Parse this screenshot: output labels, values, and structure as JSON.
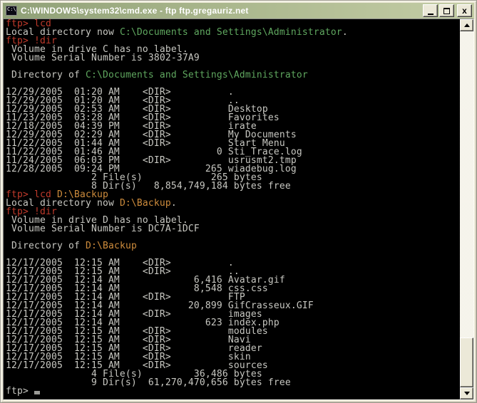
{
  "window": {
    "title": "C:\\WINDOWS\\system32\\cmd.exe - ftp ftp.gregauriz.net",
    "icon_label": "C:\\",
    "controls": {
      "minimize": "minimize-bar",
      "maximize": "square-outline",
      "close_glyph": "x"
    }
  },
  "colors": {
    "background": "#000000",
    "text": "#c8c8c2",
    "prompt_red": "#c03a2b",
    "path_green": "#5fa75f",
    "path_orange": "#ce8c3c",
    "titlebar_gradient_left": "#8fa077",
    "titlebar_gradient_right": "#c4cda6",
    "chrome_beige": "#ece9d8"
  },
  "icons": {
    "scroll_up": "triangle-up",
    "scroll_down": "triangle-down",
    "app": "cmd-console"
  },
  "console": {
    "show_cursor": true,
    "lines": [
      [
        {
          "c": "r",
          "t": "ftp> lcd"
        }
      ],
      [
        {
          "c": "w",
          "t": "Local directory now "
        },
        {
          "c": "g",
          "t": "C:\\Documents and Settings\\Administrator"
        },
        {
          "c": "w",
          "t": "."
        }
      ],
      [
        {
          "c": "r",
          "t": "ftp> !dir"
        }
      ],
      [
        {
          "c": "w",
          "t": " Volume in drive C has no label."
        }
      ],
      [
        {
          "c": "w",
          "t": " Volume Serial Number is 3802-37A9"
        }
      ],
      [],
      [
        {
          "c": "w",
          "t": " Directory of "
        },
        {
          "c": "g",
          "t": "C:\\Documents and Settings\\Administrator"
        }
      ],
      [],
      [
        {
          "c": "w",
          "t": "12/29/2005  01:20 AM    <DIR>          ."
        }
      ],
      [
        {
          "c": "w",
          "t": "12/29/2005  01:20 AM    <DIR>          .."
        }
      ],
      [
        {
          "c": "w",
          "t": "12/29/2005  02:53 AM    <DIR>          Desktop"
        }
      ],
      [
        {
          "c": "w",
          "t": "11/23/2005  03:28 AM    <DIR>          Favorites"
        }
      ],
      [
        {
          "c": "w",
          "t": "12/18/2005  04:39 PM    <DIR>          irate"
        }
      ],
      [
        {
          "c": "w",
          "t": "12/29/2005  02:29 AM    <DIR>          My Documents"
        }
      ],
      [
        {
          "c": "w",
          "t": "11/22/2005  01:44 AM    <DIR>          Start Menu"
        }
      ],
      [
        {
          "c": "w",
          "t": "11/22/2005  01:46 AM                 0 Sti_Trace.log"
        }
      ],
      [
        {
          "c": "w",
          "t": "11/24/2005  06:03 PM    <DIR>          usrusmt2.tmp"
        }
      ],
      [
        {
          "c": "w",
          "t": "12/28/2005  09:24 PM               265 wiadebug.log"
        }
      ],
      [
        {
          "c": "w",
          "t": "               2 File(s)            265 bytes"
        }
      ],
      [
        {
          "c": "w",
          "t": "               8 Dir(s)   8,854,749,184 bytes free"
        }
      ],
      [
        {
          "c": "r",
          "t": "ftp> lcd "
        },
        {
          "c": "o",
          "t": "D:\\Backup"
        }
      ],
      [
        {
          "c": "w",
          "t": "Local directory now "
        },
        {
          "c": "o",
          "t": "D:\\Backup"
        },
        {
          "c": "w",
          "t": "."
        }
      ],
      [
        {
          "c": "r",
          "t": "ftp> !dir"
        }
      ],
      [
        {
          "c": "w",
          "t": " Volume in drive D has no label."
        }
      ],
      [
        {
          "c": "w",
          "t": " Volume Serial Number is DC7A-1DCF"
        }
      ],
      [],
      [
        {
          "c": "w",
          "t": " Directory of "
        },
        {
          "c": "o",
          "t": "D:\\Backup"
        }
      ],
      [],
      [
        {
          "c": "w",
          "t": "12/17/2005  12:15 AM    <DIR>          ."
        }
      ],
      [
        {
          "c": "w",
          "t": "12/17/2005  12:15 AM    <DIR>          .."
        }
      ],
      [
        {
          "c": "w",
          "t": "12/17/2005  12:14 AM             6,416 Avatar.gif"
        }
      ],
      [
        {
          "c": "w",
          "t": "12/17/2005  12:14 AM             8,548 css.css"
        }
      ],
      [
        {
          "c": "w",
          "t": "12/17/2005  12:14 AM    <DIR>          FTP"
        }
      ],
      [
        {
          "c": "w",
          "t": "12/17/2005  12:14 AM            20,899 GifCrasseux.GIF"
        }
      ],
      [
        {
          "c": "w",
          "t": "12/17/2005  12:14 AM    <DIR>          images"
        }
      ],
      [
        {
          "c": "w",
          "t": "12/17/2005  12:14 AM               623 index.php"
        }
      ],
      [
        {
          "c": "w",
          "t": "12/17/2005  12:15 AM    <DIR>          modules"
        }
      ],
      [
        {
          "c": "w",
          "t": "12/17/2005  12:15 AM    <DIR>          Navi"
        }
      ],
      [
        {
          "c": "w",
          "t": "12/17/2005  12:15 AM    <DIR>          reader"
        }
      ],
      [
        {
          "c": "w",
          "t": "12/17/2005  12:15 AM    <DIR>          skin"
        }
      ],
      [
        {
          "c": "w",
          "t": "12/17/2005  12:15 AM    <DIR>          sources"
        }
      ],
      [
        {
          "c": "w",
          "t": "               4 File(s)         36,486 bytes"
        }
      ],
      [
        {
          "c": "w",
          "t": "               9 Dir(s)  61,270,470,656 bytes free"
        }
      ],
      [
        {
          "c": "w",
          "t": "ftp> ",
          "cursor_after": true
        }
      ]
    ]
  }
}
